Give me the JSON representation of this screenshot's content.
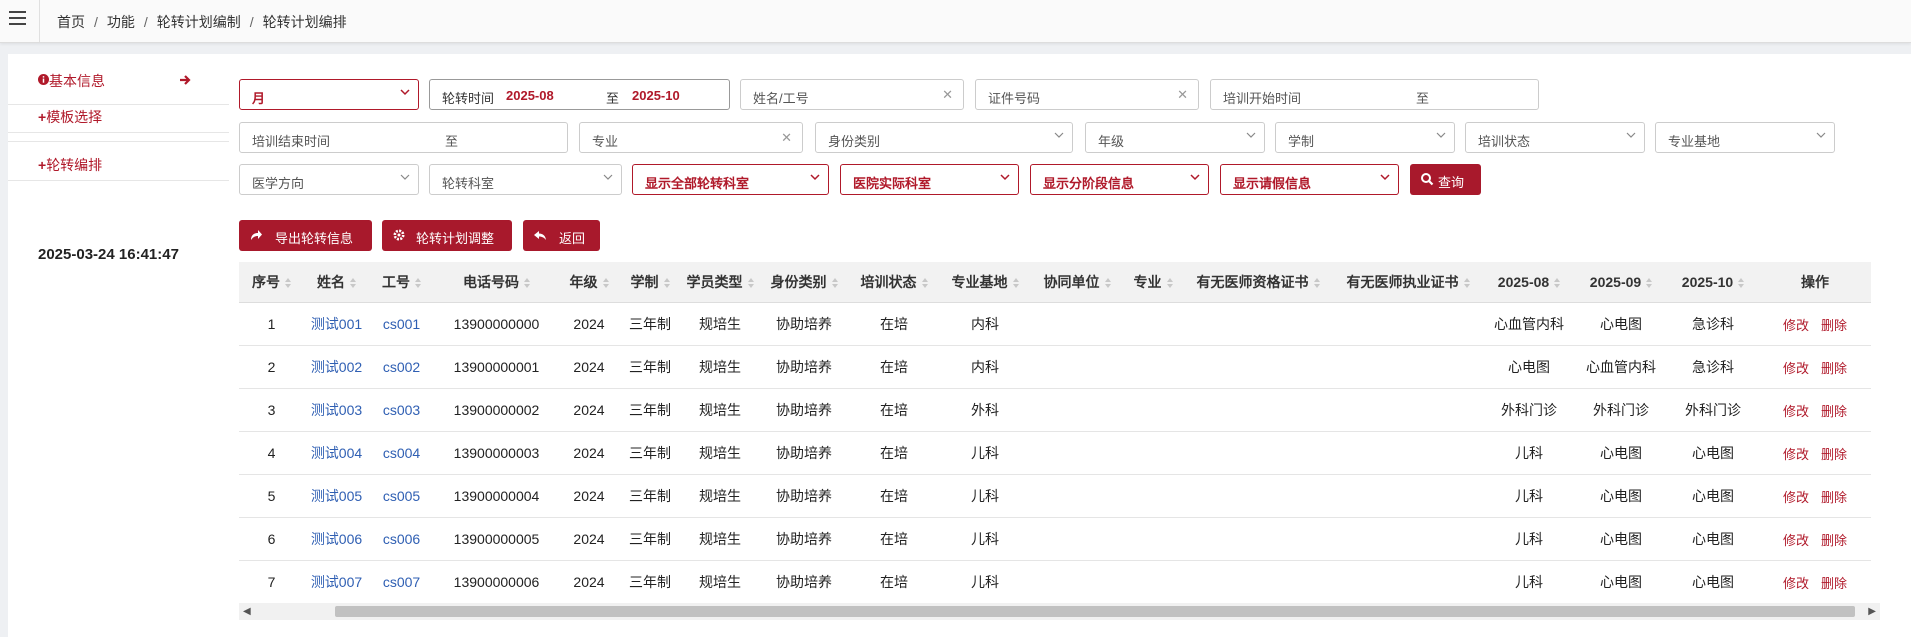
{
  "breadcrumb": {
    "items": [
      "首页",
      "功能",
      "轮转计划编制",
      "轮转计划编排"
    ]
  },
  "sidebar": {
    "items": [
      {
        "label": "基本信息"
      },
      {
        "label": "模板选择"
      },
      {
        "label": "轮转编排"
      }
    ],
    "timestamp": "2025-03-24 16:41:47"
  },
  "filters": {
    "period_select": "月",
    "rotation_time_label": "轮转时间",
    "rotation_start": "2025-08",
    "to": "至",
    "rotation_end": "2025-10",
    "name_id": "姓名/工号",
    "cert_no": "证件号码",
    "train_start": "培训开始时间",
    "train_end": "培训结束时间",
    "major": "专业",
    "identity": "身份类别",
    "grade": "年级",
    "school_system": "学制",
    "train_status": "培训状态",
    "major_base": "专业基地",
    "medical_direction": "医学方向",
    "rotation_dept": "轮转科室",
    "show_all_depts": "显示全部轮转科室",
    "hospital_dept": "医院实际科室",
    "show_stage": "显示分阶段信息",
    "show_leave": "显示请假信息",
    "query": "查询"
  },
  "actions": {
    "export": "导出轮转信息",
    "adjust": "轮转计划调整",
    "back": "返回"
  },
  "table": {
    "headers": [
      "序号",
      "姓名",
      "工号",
      "电话号码",
      "年级",
      "学制",
      "学员类型",
      "身份类别",
      "培训状态",
      "专业基地",
      "协同单位",
      "专业",
      "有无医师资格证书",
      "有无医师执业证书",
      "2025-08",
      "2025-09",
      "2025-10",
      "操作"
    ],
    "rows": [
      [
        "1",
        "测试001",
        "cs001",
        "13900000000",
        "2024",
        "三年制",
        "规培生",
        "协助培养",
        "在培",
        "内科",
        "",
        "",
        "",
        "",
        "心血管内科",
        "心电图",
        "急诊科"
      ],
      [
        "2",
        "测试002",
        "cs002",
        "13900000001",
        "2024",
        "三年制",
        "规培生",
        "协助培养",
        "在培",
        "内科",
        "",
        "",
        "",
        "",
        "心电图",
        "心血管内科",
        "急诊科"
      ],
      [
        "3",
        "测试003",
        "cs003",
        "13900000002",
        "2024",
        "三年制",
        "规培生",
        "协助培养",
        "在培",
        "外科",
        "",
        "",
        "",
        "",
        "外科门诊",
        "外科门诊",
        "外科门诊"
      ],
      [
        "4",
        "测试004",
        "cs004",
        "13900000003",
        "2024",
        "三年制",
        "规培生",
        "协助培养",
        "在培",
        "儿科",
        "",
        "",
        "",
        "",
        "儿科",
        "心电图",
        "心电图"
      ],
      [
        "5",
        "测试005",
        "cs005",
        "13900000004",
        "2024",
        "三年制",
        "规培生",
        "协助培养",
        "在培",
        "儿科",
        "",
        "",
        "",
        "",
        "儿科",
        "心电图",
        "心电图"
      ],
      [
        "6",
        "测试006",
        "cs006",
        "13900000005",
        "2024",
        "三年制",
        "规培生",
        "协助培养",
        "在培",
        "儿科",
        "",
        "",
        "",
        "",
        "儿科",
        "心电图",
        "心电图"
      ],
      [
        "7",
        "测试007",
        "cs007",
        "13900000006",
        "2024",
        "三年制",
        "规培生",
        "协助培养",
        "在培",
        "儿科",
        "",
        "",
        "",
        "",
        "儿科",
        "心电图",
        "心电图"
      ]
    ],
    "op_edit": "修改",
    "op_delete": "删除"
  },
  "colors": {
    "accent": "#a8192c",
    "link": "#2f5fb3"
  }
}
